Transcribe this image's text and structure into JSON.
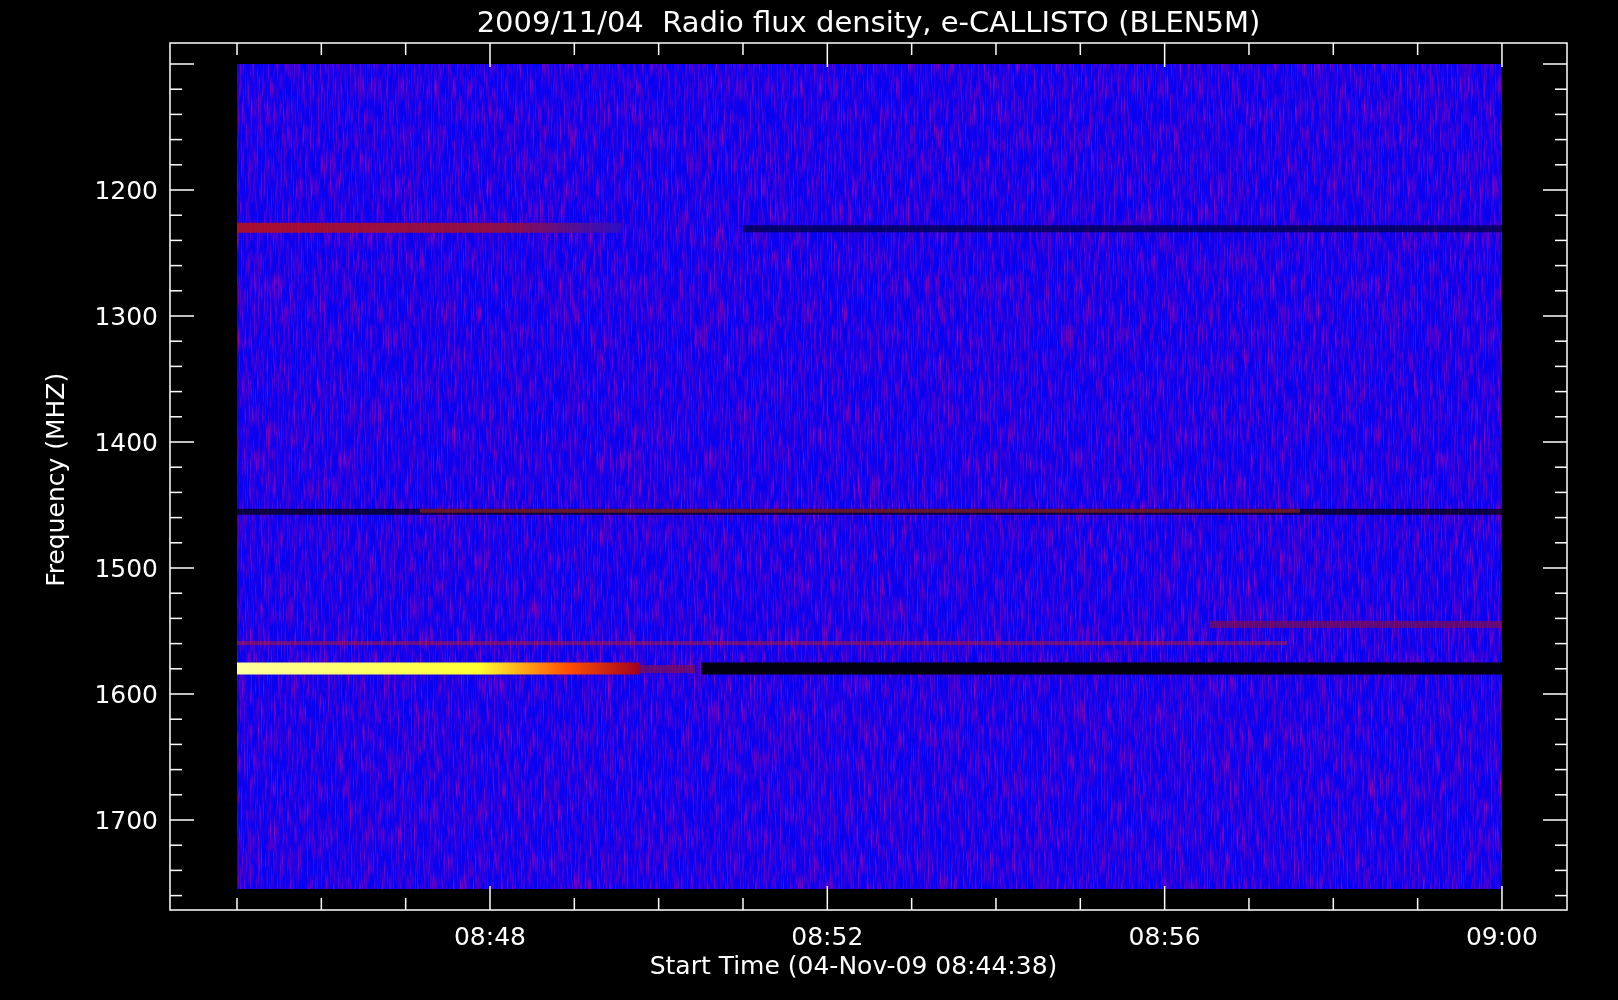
{
  "title": "2009/11/04  Radio flux density, e-CALLISTO (BLEN5M)",
  "y_axis": {
    "label": "Frequency (MHZ)",
    "ticks": [
      "1200",
      "1300",
      "1400",
      "1500",
      "1600",
      "1700"
    ]
  },
  "x_axis": {
    "label": "Start Time (04-Nov-09 08:44:38)",
    "ticks": [
      "08:48",
      "08:52",
      "08:56",
      "09:00"
    ]
  }
}
